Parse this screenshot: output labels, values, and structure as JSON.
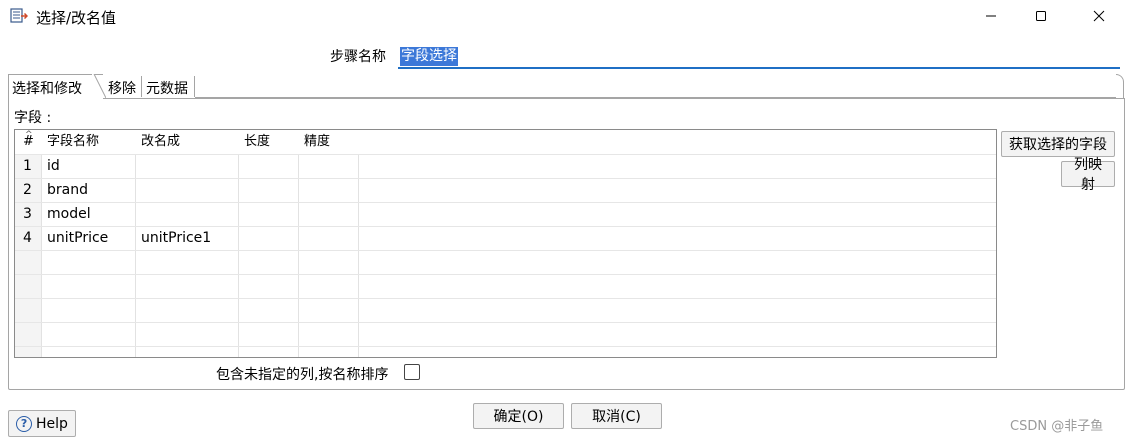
{
  "window": {
    "title": "选择/改名值",
    "min_icon": "minimize-icon",
    "max_icon": "maximize-icon",
    "close_icon": "close-icon"
  },
  "step": {
    "label": "步骤名称",
    "value": "字段选择"
  },
  "tabs": [
    {
      "label": "选择和修改",
      "active": true
    },
    {
      "label": "移除",
      "active": false
    },
    {
      "label": "元数据",
      "active": false
    }
  ],
  "fields_label": "字段 :",
  "table": {
    "headers": [
      "#",
      "字段名称",
      "改名成",
      "长度",
      "精度"
    ],
    "rows": [
      {
        "num": "1",
        "name": "id",
        "rename": "",
        "length": "",
        "precision": ""
      },
      {
        "num": "2",
        "name": "brand",
        "rename": "",
        "length": "",
        "precision": ""
      },
      {
        "num": "3",
        "name": "model",
        "rename": "",
        "length": "",
        "precision": ""
      },
      {
        "num": "4",
        "name": "unitPrice",
        "rename": "unitPrice1",
        "length": "",
        "precision": ""
      }
    ]
  },
  "buttons": {
    "get_fields": "获取选择的字段",
    "column_mapping": "列映射",
    "help": "Help",
    "ok": "确定(O)",
    "cancel": "取消(C)"
  },
  "include_unspecified": {
    "label": "包含未指定的列,按名称排序",
    "checked": false
  },
  "watermark": "CSDN @非子鱼",
  "colors": {
    "accent": "#1f6fc5",
    "selection": "#3c78d8",
    "border": "#a5a5a5"
  }
}
